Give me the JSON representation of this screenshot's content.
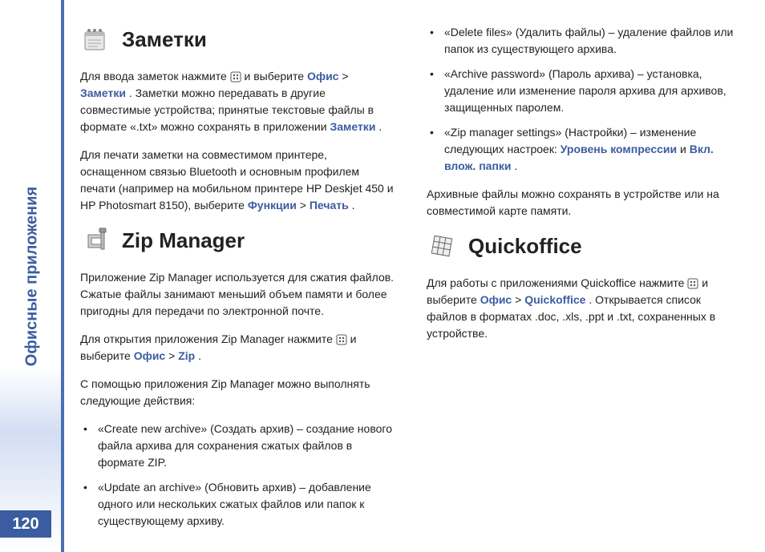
{
  "sidebar": {
    "label": "Офисные приложения"
  },
  "page_number": "120",
  "sections": {
    "notes": {
      "title": "Заметки",
      "p1a": "Для ввода заметок нажмите ",
      "p1b": " и выберите ",
      "p1_link1": "Офис",
      "p1_gt": " > ",
      "p1_link2": "Заметки",
      "p1c": ". Заметки можно передавать в другие совместимые устройства; принятые текстовые файлы в формате «.txt» можно сохранять в приложении ",
      "p1_link3": "Заметки",
      "p1d": ".",
      "p2a": "Для печати заметки на совместимом принтере, оснащенном связью Bluetooth и основным профилем печати (например на мобильном принтере HP Deskjet 450 и HP Photosmart 8150), выберите ",
      "p2_link1": "Функции",
      "p2_gt": " > ",
      "p2_link2": "Печать",
      "p2b": "."
    },
    "zip": {
      "title": "Zip Manager",
      "p1": "Приложение Zip Manager используется для сжатия файлов. Сжатые файлы занимают меньший объем памяти и более пригодны для передачи по электронной почте.",
      "p2a": "Для открытия приложения Zip Manager нажмите ",
      "p2b": " и выберите ",
      "p2_link1": "Офис",
      "p2_gt": " > ",
      "p2_link2": "Zip",
      "p2c": ".",
      "p3": "С помощью приложения Zip Manager можно выполнять следующие действия:",
      "bullets": {
        "b1": "«Create new archive» (Создать архив) – создание нового файла архива для сохранения сжатых файлов в формате ZIP.",
        "b2": "«Update an archive» (Обновить архив) – добавление одного или нескольких сжатых файлов или папок к существующему архиву.",
        "b3": "«Delete files» (Удалить файлы) – удаление файлов или папок из существующего архива.",
        "b4": "«Archive password» (Пароль архива) – установка, удаление или изменение пароля архива для архивов, защищенных паролем.",
        "b5a": "«Zip manager settings» (Настройки) – изменение следующих настроек: ",
        "b5_link1": "Уровень компрессии",
        "b5_and": " и ",
        "b5_link2": "Вкл. влож. папки",
        "b5b": "."
      },
      "p4": "Архивные файлы можно сохранять в устройстве или на совместимой карте памяти."
    },
    "qo": {
      "title": "Quickoffice",
      "p1a": "Для работы с приложениями Quickoffice нажмите ",
      "p1b": " и выберите ",
      "p1_link1": "Офис",
      "p1_gt": " > ",
      "p1_link2": "Quickoffice",
      "p1c": ". Открывается список файлов в форматах .doc, .xls, .ppt и .txt, сохраненных в устройстве."
    }
  }
}
